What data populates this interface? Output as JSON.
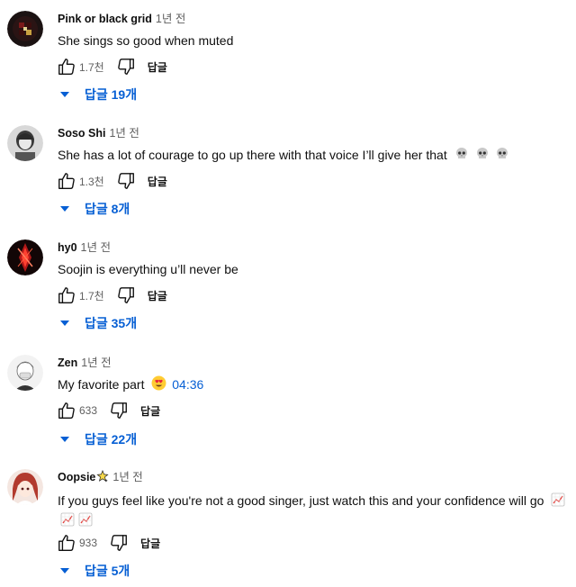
{
  "colors": {
    "link": "#065fd4",
    "meta": "#606060",
    "text": "#0f0f0f"
  },
  "comments": [
    {
      "author": "Pink or black grid",
      "time": "1년 전",
      "text": "She sings so good when muted",
      "likes": "1.7천",
      "reply_label": "답글",
      "replies_label": "답글 19개",
      "avatar": "dark-red-grid-avatar"
    },
    {
      "author": "Soso Shi",
      "time": "1년 전",
      "text": "She has a lot of courage to go up there with that voice I’ll give her that",
      "emoji": "skull-emoji",
      "likes": "1.3천",
      "reply_label": "답글",
      "replies_label": "답글 8개",
      "avatar": "grayscale-portrait-avatar"
    },
    {
      "author": "hy0",
      "time": "1년 전",
      "text": "Soojin is everything u’ll never be",
      "likes": "1.7천",
      "reply_label": "답글",
      "replies_label": "답글 35개",
      "avatar": "red-glow-anime-avatar"
    },
    {
      "author": "Zen",
      "time": "1년 전",
      "text": "My favorite part",
      "emoji": "heart-eyes-emoji",
      "timestamp_link": "04:36",
      "likes": "633",
      "reply_label": "답글",
      "replies_label": "답글 22개",
      "avatar": "sketch-anime-avatar"
    },
    {
      "author": "Oopsie",
      "author_badge": "sparkle-star-emoji",
      "time": "1년 전",
      "text": "If you guys feel like you're not a good singer, just watch this and your confidence will go",
      "emoji": "chart-increasing-emoji",
      "likes": "933",
      "reply_label": "답글",
      "replies_label": "답글 5개",
      "avatar": "red-hair-anime-avatar"
    }
  ]
}
